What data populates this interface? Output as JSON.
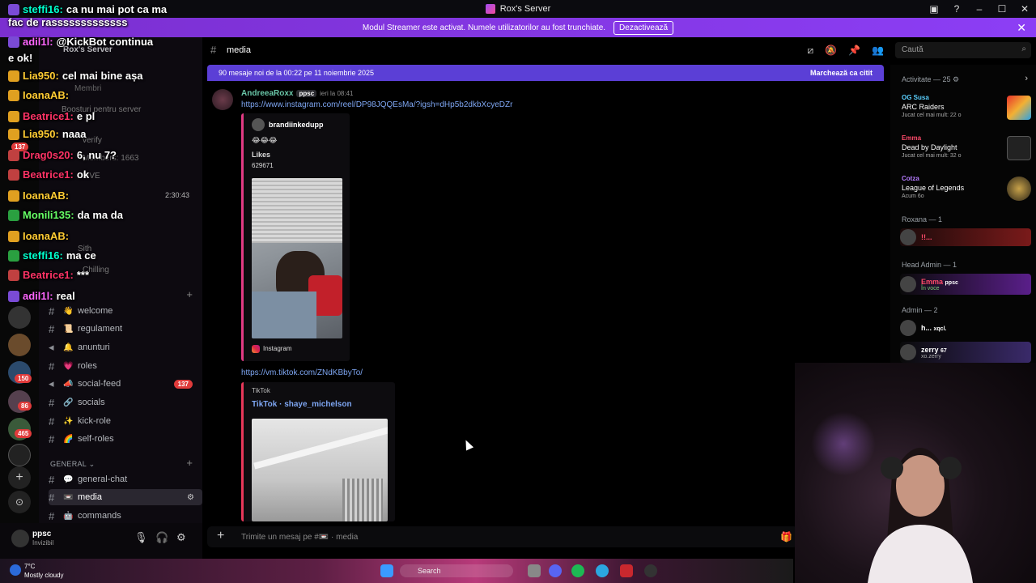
{
  "titlebar": {
    "title": "Rox's Server",
    "icons": [
      "inbox-icon",
      "help-icon",
      "minimize-icon",
      "maximize-icon",
      "close-icon"
    ]
  },
  "banner": {
    "text": "Modul Streamer este activat. Numele utilizatorilor au fost trunchiate.",
    "button": "Dezactivează",
    "close": "✕"
  },
  "server": {
    "name": "Rox's Server"
  },
  "rail": {
    "badges": [
      "137",
      "150",
      "86",
      "465"
    ]
  },
  "overlay_chat": [
    {
      "user": "steffi16:",
      "text": "ca nu mai pot ca ma",
      "color": "#00ffcc"
    },
    {
      "user": "",
      "text": "fac de rasssssssssssss",
      "color": "#ffffff"
    },
    {
      "user": "adil1l:",
      "text": "@KickBot continua",
      "color": "#ff66ff"
    },
    {
      "user": "",
      "text": "e ok!",
      "color": "#ffffff"
    },
    {
      "user": "Lia950:",
      "text": "cel mai bine așa",
      "color": "#ffcc33"
    },
    {
      "user": "IoanaAB:",
      "text": "",
      "color": "#ffcc33"
    },
    {
      "user": "Beatrice1:",
      "text": "e pl",
      "color": "#ff3366"
    },
    {
      "user": "Lia950:",
      "text": "naaa",
      "color": "#ffcc33"
    },
    {
      "user": "Drag0s20:",
      "text": "6, nu 7?",
      "color": "#ff3366"
    },
    {
      "user": "Beatrice1:",
      "text": "ok",
      "color": "#ff3366"
    },
    {
      "user": "IoanaAB:",
      "text": "",
      "color": "#ffcc33"
    },
    {
      "user": "Monili135:",
      "text": "da ma da",
      "color": "#66ff66"
    },
    {
      "user": "IoanaAB:",
      "text": "",
      "color": "#ffcc33"
    },
    {
      "user": "steffi16:",
      "text": "ma ce",
      "color": "#00ffcc"
    },
    {
      "user": "Beatrice1:",
      "text": "***",
      "color": "#ff3366"
    },
    {
      "user": "adil1l:",
      "text": "real",
      "color": "#ff66ff"
    }
  ],
  "sidebar": {
    "faded_items": [
      "Membri",
      "Boosturi pentru server",
      "verify",
      "Members: 1663",
      "LIVE",
      "Sith",
      "Chilling"
    ],
    "timer": "2:30:43",
    "channels_top": [
      {
        "label": "welcome",
        "emoji": "👋"
      },
      {
        "label": "regulament",
        "emoji": "📜"
      },
      {
        "label": "anunturi",
        "emoji": "🔔"
      },
      {
        "label": "roles",
        "emoji": "💗"
      },
      {
        "label": "social-feed",
        "emoji": "📣",
        "count": "137"
      },
      {
        "label": "socials",
        "emoji": "🔗"
      },
      {
        "label": "kick-role",
        "emoji": "✨"
      },
      {
        "label": "self-roles",
        "emoji": "🌈"
      }
    ],
    "category": "GENERAL",
    "channels_general": [
      {
        "label": "general-chat",
        "emoji": "💬"
      },
      {
        "label": "media",
        "emoji": "📼",
        "active": true
      },
      {
        "label": "commands",
        "emoji": "🤖"
      }
    ]
  },
  "user_panel": {
    "name": "ppsc",
    "status": "Invizibil"
  },
  "channel_header": {
    "title": "media",
    "search_placeholder": "Caută"
  },
  "new_messages": {
    "text": "90 mesaje noi de la 00:22 pe 11 noiembrie 2025",
    "mark_read": "Marchează ca citit"
  },
  "message": {
    "author": "AndreeaRoxx",
    "tag": "ppsc",
    "time": "ieri la 08:41",
    "link1": "https://www.instagram.com/reel/DP98JQQEsMa/?igsh=dHp5b2dkbXcyeDZr",
    "embed1": {
      "account": "brandiinkedupp",
      "emojis": "😂😂😂",
      "likes_label": "Likes",
      "likes": "629671",
      "footer": "Instagram"
    },
    "link2": "https://vm.tiktok.com/ZNdKBbyTo/",
    "embed2": {
      "provider": "TikTok",
      "title": "TikTok · shaye_michelson"
    }
  },
  "composer": {
    "placeholder": "Trimite un mesaj pe #📼 · media"
  },
  "members": {
    "activity_header": "Activitate — 25",
    "activities": [
      {
        "user": "OG Susa",
        "game": "ARC Raiders",
        "meta": "Jucat cel mai mult: 22 o",
        "color": "#5ad0ff"
      },
      {
        "user": "Emma",
        "game": "Dead by Daylight",
        "meta": "Jucat cel mai mult: 32 o",
        "color": "#ff4a6a"
      },
      {
        "user": "Cotza",
        "game": "League of Legends",
        "meta": "Acum 6o",
        "color": "#b67cff"
      }
    ],
    "groups": [
      {
        "header": "Roxana — 1",
        "rows": [
          {
            "name": "!!...",
            "color": "#ff4a6a",
            "sub": ""
          }
        ]
      },
      {
        "header": "Head Admin — 1",
        "rows": [
          {
            "name": "Emma",
            "color": "#ff4a6a",
            "sub": "În voce",
            "tag": "ppsc"
          }
        ]
      },
      {
        "header": "Admin — 2",
        "rows": [
          {
            "name": "h...",
            "color": "#ffffff",
            "sub": "",
            "tag": "xqcl."
          },
          {
            "name": "zerry",
            "color": "#ffffff",
            "sub": "xo.zerry",
            "tag": "67"
          }
        ]
      }
    ]
  },
  "taskbar": {
    "temp": "7°C",
    "weather": "Mostly cloudy",
    "search": "Search"
  }
}
